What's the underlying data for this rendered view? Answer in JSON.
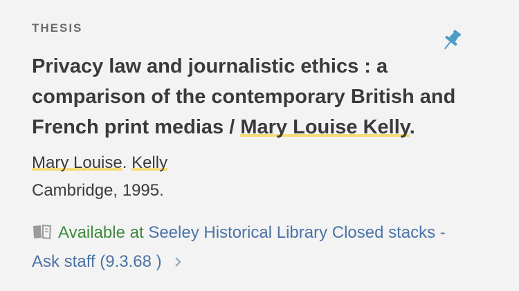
{
  "record": {
    "type_label": "THESIS",
    "title_main": "Privacy law and journalistic ethics : a comparison of the contemporary British and French print medias / ",
    "title_author": "Mary Louise Kelly",
    "title_end": ".",
    "author_first": "Mary Louise",
    "author_sep": ". ",
    "author_last": "Kelly",
    "publication": "Cambridge, 1995."
  },
  "availability": {
    "status": "Available at ",
    "location": "Seeley Historical Library  Closed stacks - Ask staff (9.3.68 )"
  },
  "icons": {
    "pin": "pushpin-icon",
    "book": "book-icon",
    "chevron": "chevron-right-icon"
  },
  "colors": {
    "background": "#f3f3f3",
    "highlight": "#f6dd7a",
    "available": "#3e8a3e",
    "link": "#4a73a6",
    "pin": "#4a9bc4"
  }
}
